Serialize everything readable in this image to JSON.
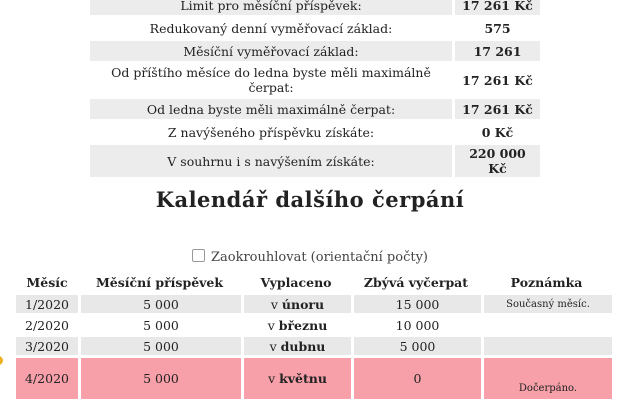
{
  "summary": [
    {
      "label": "Limit pro měsíční příspěvek:",
      "value": "17 261 Kč",
      "shade": true
    },
    {
      "label": "Redukovaný denní vyměřovací základ:",
      "value": "575",
      "shade": false
    },
    {
      "label": "Měsíční vyměřovací základ:",
      "value": "17 261",
      "shade": true
    },
    {
      "label": "Od příštího měsíce do ledna byste měli maximálně čerpat:",
      "value": "17 261 Kč",
      "shade": false
    },
    {
      "label": "Od ledna byste měli maximálně čerpat:",
      "value": "17 261 Kč",
      "shade": true
    },
    {
      "label": "Z navýšeného příspěvku získáte:",
      "value": "0 Kč",
      "shade": false
    },
    {
      "label": "V souhrnu i s navýšením získáte:",
      "value": "220 000 Kč",
      "shade": true
    }
  ],
  "calendar": {
    "title": "Kalendář dalšího čerpání",
    "round_label": "Zaokrouhlovat (orientační počty)",
    "round_checked": false,
    "headers": [
      "Měsíc",
      "Měsíční příspěvek",
      "Vyplaceno",
      "Zbývá vyčerpat",
      "Poznámka"
    ],
    "rows": [
      {
        "month": "1/2020",
        "contribution": "5 000",
        "paid_prefix": "v",
        "paid_month": "únoru",
        "remaining": "15 000",
        "note": "Současný měsíc."
      },
      {
        "month": "2/2020",
        "contribution": "5 000",
        "paid_prefix": "v",
        "paid_month": "březnu",
        "remaining": "10 000",
        "note": ""
      },
      {
        "month": "3/2020",
        "contribution": "5 000",
        "paid_prefix": "v",
        "paid_month": "dubnu",
        "remaining": "5 000",
        "note": ""
      },
      {
        "month": "4/2020",
        "contribution": "5 000",
        "paid_prefix": "v",
        "paid_month": "květnu",
        "remaining": "0",
        "note": "Dočerpáno."
      }
    ]
  }
}
